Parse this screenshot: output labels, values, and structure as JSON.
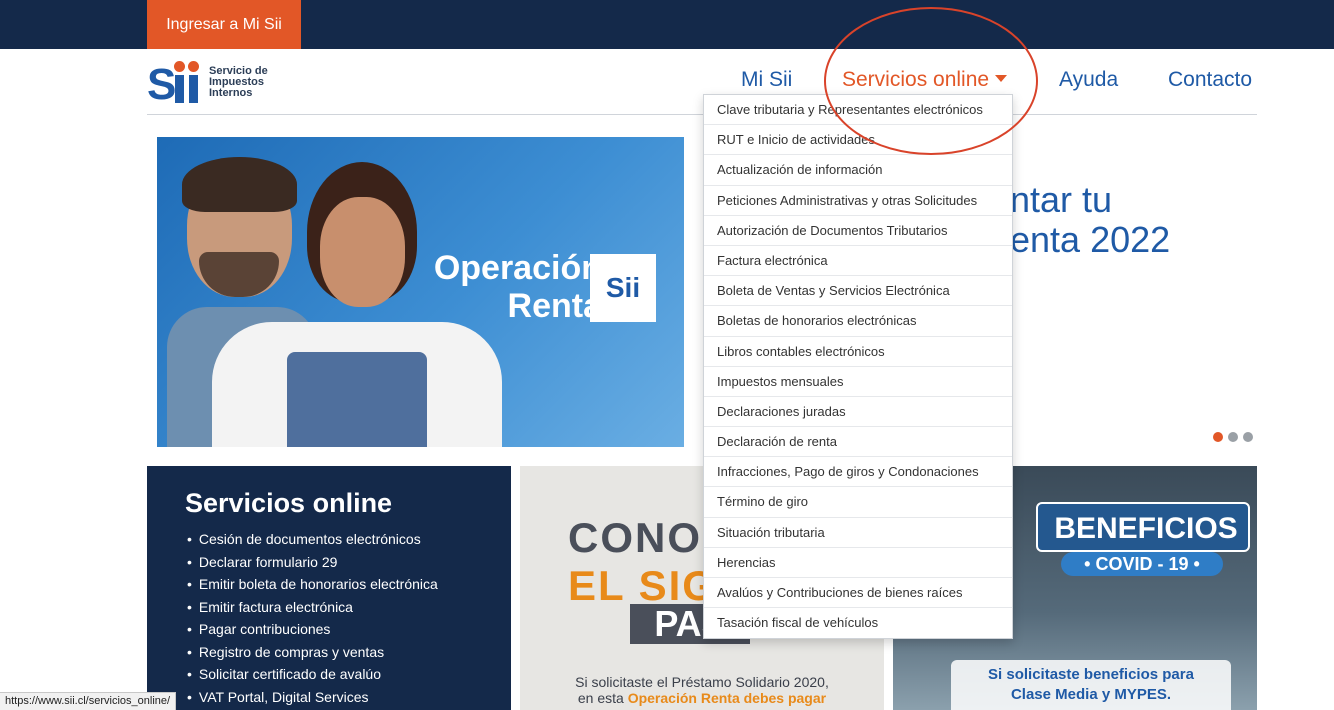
{
  "topbar": {
    "login_label": "Ingresar a Mi Sii"
  },
  "logo": {
    "line1": "Servicio de",
    "line2": "Impuestos",
    "line3": "Internos"
  },
  "nav": {
    "mi_sii": "Mi Sii",
    "servicios": "Servicios online",
    "ayuda": "Ayuda",
    "contacto": "Contacto"
  },
  "dropdown": {
    "items": [
      "Clave tributaria y Representantes electrónicos",
      "RUT e Inicio de actividades",
      "Actualización de información",
      "Peticiones Administrativas y otras Solicitudes",
      "Autorización de Documentos Tributarios",
      "Factura electrónica",
      "Boleta de Ventas y Servicios Electrónica",
      "Boletas de honorarios electrónicas",
      "Libros contables electrónicos",
      "Impuestos mensuales",
      "Declaraciones juradas",
      "Declaración de renta",
      "Infracciones, Pago de giros y Condonaciones",
      "Término de giro",
      "Situación tributaria",
      "Herencias",
      "Avalúos y Contribuciones de bienes raíces",
      "Tasación fiscal de vehículos"
    ]
  },
  "hero": {
    "title_line1": "Operación",
    "title_line2": "Renta",
    "badge": "Sii",
    "right_line1": "ntar tu",
    "right_line2": "enta 2022"
  },
  "panel_servicios": {
    "title": "Servicios online",
    "items": [
      "Cesión de documentos electrónicos",
      "Declarar formulario 29",
      "Emitir boleta de honorarios electrónica",
      "Emitir factura electrónica",
      "Pagar contribuciones",
      "Registro de compras y ventas",
      "Solicitar certificado de avalúo",
      "VAT Portal, Digital Services"
    ]
  },
  "panel_mid": {
    "big1": "CONOC",
    "big2": "EL SIG",
    "box": "PAS",
    "text_line1": "Si solicitaste el Préstamo Solidario 2020,",
    "text_prefix": "en esta ",
    "text_highlight": "Operación Renta debes pagar"
  },
  "panel_right": {
    "title": "BENEFICIOS",
    "covid": "• COVID - 19 •",
    "text_line1": "Si solicitaste beneficios para",
    "text_line2": "Clase Media y MYPES."
  },
  "statusbar": {
    "url": "https://www.sii.cl/servicios_online/"
  },
  "colors": {
    "navy": "#14294a",
    "orange": "#e25727",
    "blue": "#1f5aa6"
  }
}
